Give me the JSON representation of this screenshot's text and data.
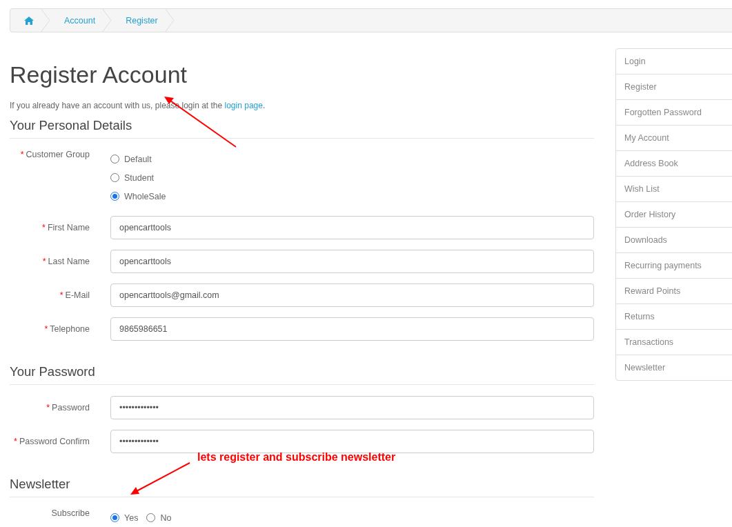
{
  "breadcrumb": [
    {
      "kind": "home"
    },
    {
      "kind": "link",
      "label": "Account"
    },
    {
      "kind": "link",
      "label": "Register"
    }
  ],
  "title": "Register Account",
  "intro": {
    "text": "If you already have an account with us, please login at the ",
    "link": "login page",
    "end": "."
  },
  "sections": [
    {
      "heading": "Your Personal Details",
      "fields": [
        {
          "kind": "radio",
          "label": "Customer Group",
          "required_mark": "*",
          "options": [
            {
              "label": "Default",
              "selected": false
            },
            {
              "label": "Student",
              "selected": false
            },
            {
              "label": "WholeSale",
              "selected": true
            }
          ]
        },
        {
          "kind": "text",
          "label": "First Name",
          "required_mark": "*",
          "value": "opencarttools"
        },
        {
          "kind": "text",
          "label": "Last Name",
          "required_mark": "*",
          "value": "opencarttools"
        },
        {
          "kind": "text",
          "label": "E-Mail",
          "required_mark": "*",
          "value": "opencarttools@gmail.com"
        },
        {
          "kind": "text",
          "label": "Telephone",
          "required_mark": "*",
          "value": "9865986651"
        }
      ]
    },
    {
      "heading": "Your Password",
      "fields": [
        {
          "kind": "text",
          "label": "Password",
          "required_mark": "*",
          "value": "•••••••••••••"
        },
        {
          "kind": "text",
          "label": "Password Confirm",
          "required_mark": "*",
          "value": "•••••••••••••"
        }
      ]
    },
    {
      "heading": "Newsletter",
      "fields": [
        {
          "kind": "inline-radio",
          "label": "Subscribe",
          "options": [
            {
              "label": "Yes",
              "selected": true
            },
            {
              "label": "No",
              "selected": false
            }
          ]
        }
      ]
    }
  ],
  "sidebar": {
    "items": [
      "Login",
      "Register",
      "Forgotten Password",
      "My Account",
      "Address Book",
      "Wish List",
      "Order History",
      "Downloads",
      "Recurring payments",
      "Reward Points",
      "Returns",
      "Transactions",
      "Newsletter"
    ]
  },
  "annotations": [
    {
      "kind": "arrow-up"
    },
    {
      "kind": "note",
      "text": "lets register and subscribe newsletter"
    },
    {
      "kind": "arrow-down"
    }
  ]
}
